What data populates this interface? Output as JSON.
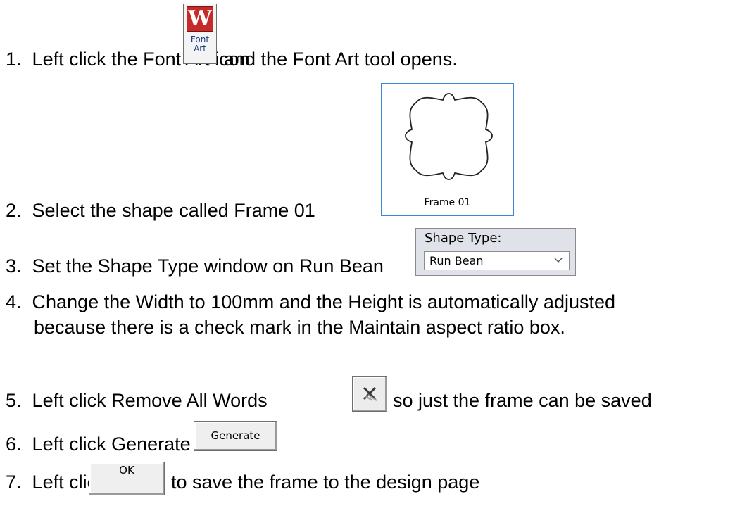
{
  "steps": [
    {
      "num": "1.",
      "before": "Left click the Font Art icon",
      "after": "and the Font Art tool opens."
    },
    {
      "num": "2.",
      "before": "Select the shape called Frame 01",
      "after": ""
    },
    {
      "num": "3.",
      "before": "Set the Shape Type window on Run Bean",
      "after": ""
    },
    {
      "num": "4.",
      "before": "Change the Width to 100mm and the Height is automatically adjusted",
      "continuation": "because there is a check mark in the Maintain aspect ratio box."
    },
    {
      "num": "5.",
      "before": "Left click Remove All Words",
      "after": "so just the frame can be saved"
    },
    {
      "num": "6.",
      "before": "Left click Generate",
      "after": ""
    },
    {
      "num": "7.",
      "before": "Left click OK",
      "after": "to save the frame to the design page"
    }
  ],
  "font_art_icon": {
    "letter": "W",
    "label_line1": "Font",
    "label_line2": "Art"
  },
  "frame_tile": {
    "caption": "Frame 01"
  },
  "shape_type": {
    "title": "Shape Type:",
    "value": "Run Bean"
  },
  "buttons": {
    "generate": "Generate",
    "ok": "OK"
  },
  "icons": {
    "font_art": "font-art-icon",
    "remove_words": "remove-all-words-icon",
    "dropdown": "chevron-down-icon"
  }
}
